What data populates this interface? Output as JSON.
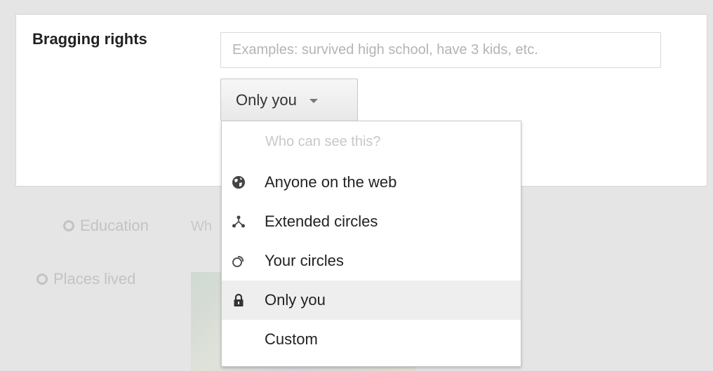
{
  "field": {
    "label": "Bragging rights",
    "placeholder": "Examples: survived high school, have 3 kids, etc."
  },
  "visibility_button": {
    "label": "Only you"
  },
  "background_items": {
    "education": "Education",
    "places_lived": "Places lived",
    "education_hint": "Wh"
  },
  "dropdown": {
    "header": "Who can see this?",
    "items": [
      {
        "label": "Anyone on the web",
        "icon": "globe-icon"
      },
      {
        "label": "Extended circles",
        "icon": "extended-circles-icon"
      },
      {
        "label": "Your circles",
        "icon": "circles-icon"
      },
      {
        "label": "Only you",
        "icon": "lock-icon",
        "selected": true
      },
      {
        "label": "Custom",
        "icon": ""
      }
    ]
  }
}
